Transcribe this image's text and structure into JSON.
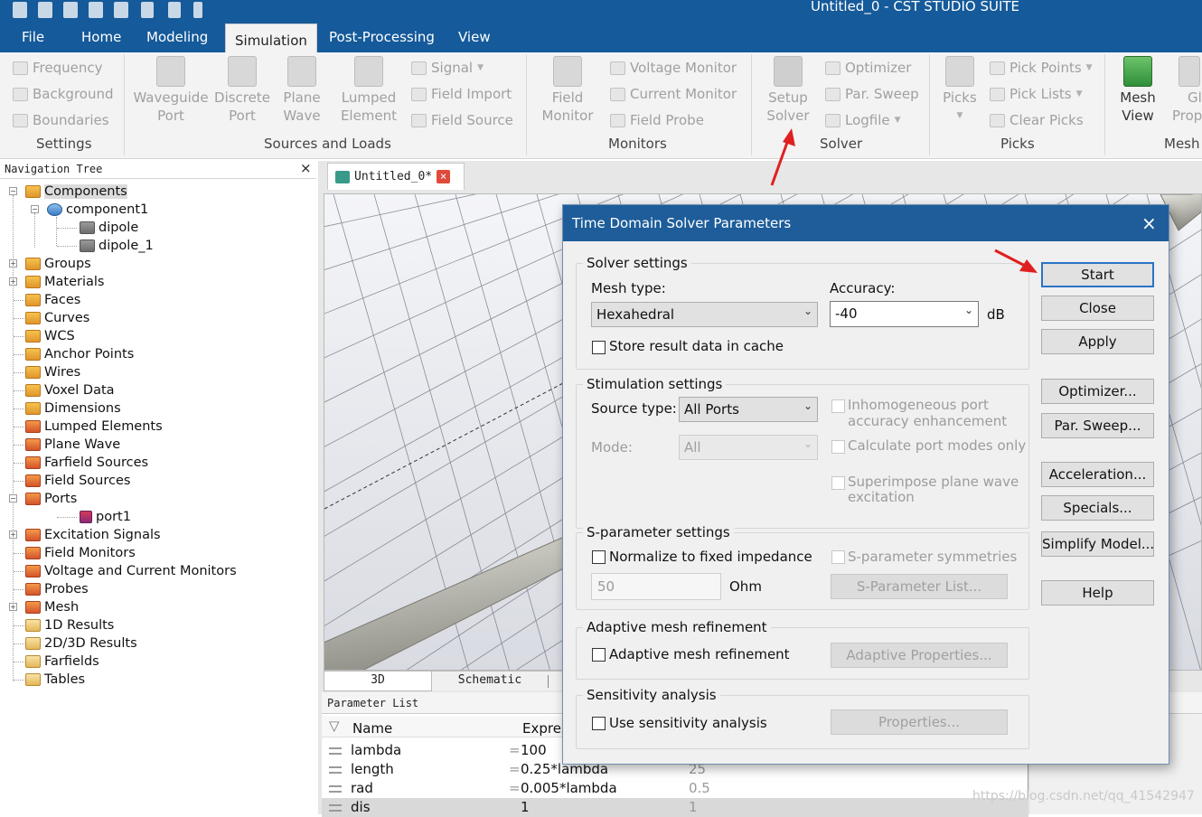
{
  "app": {
    "title": "Untitled_0 - CST STUDIO SUITE"
  },
  "menu": {
    "file": "File",
    "home": "Home",
    "modeling": "Modeling",
    "simulation": "Simulation",
    "post_processing": "Post-Processing",
    "view": "View"
  },
  "ribbon": {
    "settings": {
      "frequency": "Frequency",
      "background": "Background",
      "boundaries": "Boundaries",
      "group": "Settings"
    },
    "sources": {
      "waveguide1": "Waveguide",
      "waveguide2": "Port",
      "discrete1": "Discrete",
      "discrete2": "Port",
      "plane1": "Plane",
      "plane2": "Wave",
      "lumped1": "Lumped",
      "lumped2": "Element",
      "signal": "Signal",
      "field_import": "Field Import",
      "field_source": "Field Source",
      "group": "Sources and Loads"
    },
    "monitors": {
      "field1": "Field",
      "field2": "Monitor",
      "voltage": "Voltage Monitor",
      "current": "Current Monitor",
      "probe": "Field Probe",
      "group": "Monitors"
    },
    "solver": {
      "setup1": "Setup",
      "setup2": "Solver",
      "optimizer": "Optimizer",
      "par_sweep": "Par. Sweep",
      "logfile": "Logfile",
      "group": "Solver"
    },
    "picks": {
      "picks": "Picks",
      "pick_points": "Pick Points",
      "pick_lists": "Pick Lists",
      "clear_picks": "Clear Picks",
      "group": "Picks"
    },
    "mesh": {
      "mesh1": "Mesh",
      "mesh2": "View",
      "gl1": "Gl",
      "gl2": "Prop",
      "group": "Mesh"
    }
  },
  "nav": {
    "title": "Navigation Tree",
    "close": "×",
    "items": [
      "Components",
      "component1",
      "dipole",
      "dipole_1",
      "Groups",
      "Materials",
      "Faces",
      "Curves",
      "WCS",
      "Anchor Points",
      "Wires",
      "Voxel Data",
      "Dimensions",
      "Lumped Elements",
      "Plane Wave",
      "Farfield Sources",
      "Field Sources",
      "Ports",
      "port1",
      "Excitation Signals",
      "Field Monitors",
      "Voltage and Current Monitors",
      "Probes",
      "Mesh",
      "1D Results",
      "2D/3D Results",
      "Farfields",
      "Tables"
    ]
  },
  "doc": {
    "tab": "Untitled_0*",
    "tab_close": "×",
    "view_tabs": [
      "3D",
      "Schematic"
    ]
  },
  "params": {
    "title": "Parameter List",
    "headers": {
      "name": "Name",
      "expression": "Expres"
    },
    "rows": [
      {
        "name": "lambda",
        "expr": "100",
        "value": ""
      },
      {
        "name": "length",
        "expr": "0.25*lambda",
        "value": "25"
      },
      {
        "name": "rad",
        "expr": "0.005*lambda",
        "value": "0.5"
      },
      {
        "name": "dis",
        "expr": "1",
        "value": "1"
      }
    ]
  },
  "dialog": {
    "title": "Time Domain Solver Parameters",
    "close": "×",
    "solver_settings": {
      "group": "Solver settings",
      "mesh_type_label": "Mesh type:",
      "mesh_type": "Hexahedral",
      "accuracy_label": "Accuracy:",
      "accuracy": "-40",
      "unit": "dB",
      "store_cache": "Store result data in cache"
    },
    "stimulation": {
      "group": "Stimulation settings",
      "source_type_label": "Source type:",
      "source_type": "All Ports",
      "mode_label": "Mode:",
      "mode": "All",
      "inhomogeneous_1": "Inhomogeneous port",
      "inhomogeneous_2": "accuracy enhancement",
      "calc_modes": "Calculate port modes only",
      "superimpose_1": "Superimpose plane wave",
      "superimpose_2": "excitation"
    },
    "sparam": {
      "group": "S-parameter settings",
      "normalize": "Normalize to fixed impedance",
      "impedance": "50",
      "ohm": "Ohm",
      "symmetries": "S-parameter symmetries",
      "list_button": "S-Parameter List..."
    },
    "adaptive": {
      "group": "Adaptive mesh refinement",
      "check": "Adaptive mesh refinement",
      "button": "Adaptive Properties..."
    },
    "sensitivity": {
      "group": "Sensitivity analysis",
      "check": "Use sensitivity analysis",
      "button": "Properties..."
    },
    "buttons": {
      "start": "Start",
      "close": "Close",
      "apply": "Apply",
      "optimizer": "Optimizer...",
      "par_sweep": "Par. Sweep...",
      "acceleration": "Acceleration...",
      "specials": "Specials...",
      "simplify": "Simplify Model...",
      "help": "Help"
    }
  },
  "watermark": "https://blog.csdn.net/qq_41542947",
  "colors": {
    "title_bar": "#155a9a",
    "dialog_title": "#1e5d9a",
    "annotation_arrow": "#e02020",
    "default_button_border": "#2a74c4"
  }
}
